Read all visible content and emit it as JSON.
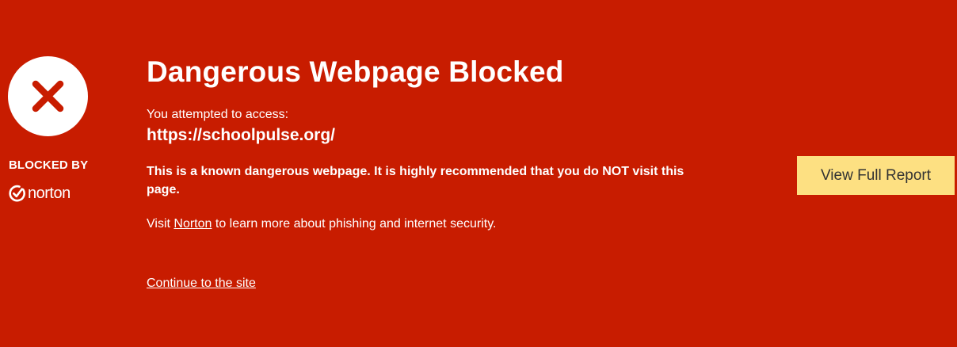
{
  "colors": {
    "background": "#c81c00",
    "text": "#ffffff",
    "button_bg": "#fde082",
    "button_text": "#333333",
    "icon_cross": "#c81c00"
  },
  "sidebar": {
    "status_icon": "blocked-cross-icon",
    "blocked_by_label": "BLOCKED BY",
    "brand_icon": "norton-check-icon",
    "brand_name": "norton"
  },
  "main": {
    "title": "Dangerous Webpage Blocked",
    "attempt_label": "You attempted to access:",
    "blocked_url": "https://schoolpulse.org/",
    "warning": "This is a known dangerous webpage. It is highly recommended that you do NOT visit this page.",
    "learn_more": {
      "prefix": "Visit ",
      "link_text": "Norton",
      "suffix": " to learn more about phishing and internet security."
    },
    "continue_link": "Continue to the site"
  },
  "actions": {
    "view_report_label": "View Full Report"
  }
}
